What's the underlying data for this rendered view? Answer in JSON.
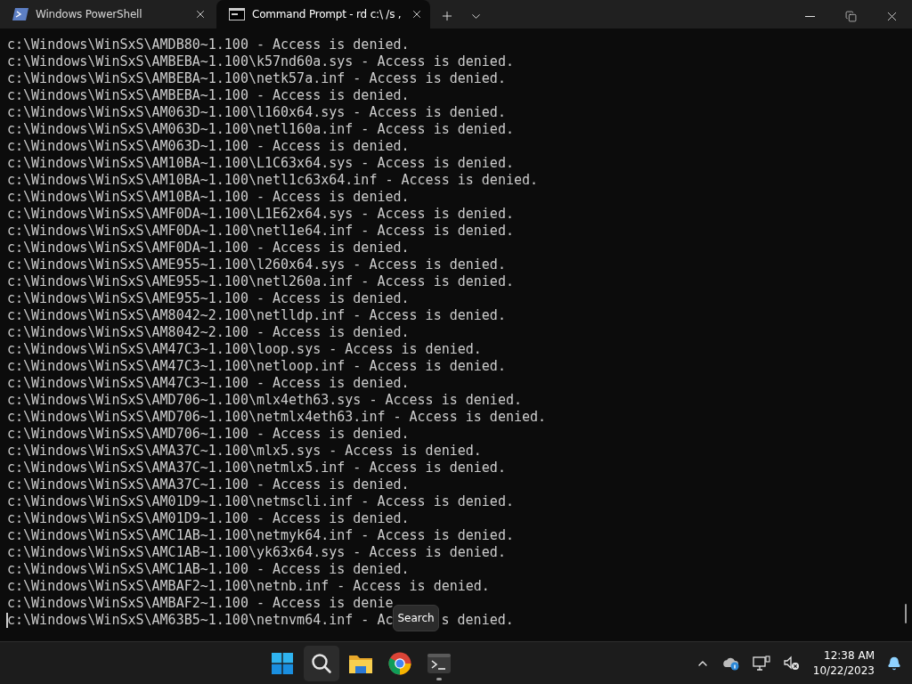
{
  "tabs": [
    {
      "title": "Windows PowerShell",
      "kind": "powershell",
      "selected": false
    },
    {
      "title": "Command Prompt - rd  c:\\ /s ,",
      "kind": "cmd",
      "selected": true
    }
  ],
  "terminal": {
    "lines": [
      {
        "text": "c:\\Windows\\WinSxS\\AMDB80~1.100 - Access is denied."
      },
      {
        "text": "c:\\Windows\\WinSxS\\AMBEBA~1.100\\k57nd60a.sys - Access is denied."
      },
      {
        "text": "c:\\Windows\\WinSxS\\AMBEBA~1.100\\netk57a.inf - Access is denied."
      },
      {
        "text": "c:\\Windows\\WinSxS\\AMBEBA~1.100 - Access is denied."
      },
      {
        "text": "c:\\Windows\\WinSxS\\AM063D~1.100\\l160x64.sys - Access is denied."
      },
      {
        "text": "c:\\Windows\\WinSxS\\AM063D~1.100\\netl160a.inf - Access is denied."
      },
      {
        "text": "c:\\Windows\\WinSxS\\AM063D~1.100 - Access is denied."
      },
      {
        "text": "c:\\Windows\\WinSxS\\AM10BA~1.100\\L1C63x64.sys - Access is denied."
      },
      {
        "text": "c:\\Windows\\WinSxS\\AM10BA~1.100\\netl1c63x64.inf - Access is denied."
      },
      {
        "text": "c:\\Windows\\WinSxS\\AM10BA~1.100 - Access is denied."
      },
      {
        "text": "c:\\Windows\\WinSxS\\AMF0DA~1.100\\L1E62x64.sys - Access is denied."
      },
      {
        "text": "c:\\Windows\\WinSxS\\AMF0DA~1.100\\netl1e64.inf - Access is denied."
      },
      {
        "text": "c:\\Windows\\WinSxS\\AMF0DA~1.100 - Access is denied."
      },
      {
        "text": "c:\\Windows\\WinSxS\\AME955~1.100\\l260x64.sys - Access is denied."
      },
      {
        "text": "c:\\Windows\\WinSxS\\AME955~1.100\\netl260a.inf - Access is denied."
      },
      {
        "text": "c:\\Windows\\WinSxS\\AME955~1.100 - Access is denied."
      },
      {
        "text": "c:\\Windows\\WinSxS\\AM8042~2.100\\netlldp.inf - Access is denied."
      },
      {
        "text": "c:\\Windows\\WinSxS\\AM8042~2.100 - Access is denied."
      },
      {
        "text": "c:\\Windows\\WinSxS\\AM47C3~1.100\\loop.sys - Access is denied."
      },
      {
        "text": "c:\\Windows\\WinSxS\\AM47C3~1.100\\netloop.inf - Access is denied."
      },
      {
        "text": "c:\\Windows\\WinSxS\\AM47C3~1.100 - Access is denied."
      },
      {
        "text": "c:\\Windows\\WinSxS\\AMD706~1.100\\mlx4eth63.sys - Access is denied."
      },
      {
        "text": "c:\\Windows\\WinSxS\\AMD706~1.100\\netmlx4eth63.inf - Access is denied."
      },
      {
        "text": "c:\\Windows\\WinSxS\\AMD706~1.100 - Access is denied."
      },
      {
        "text": "c:\\Windows\\WinSxS\\AMA37C~1.100\\mlx5.sys - Access is denied."
      },
      {
        "text": "c:\\Windows\\WinSxS\\AMA37C~1.100\\netmlx5.inf - Access is denied."
      },
      {
        "text": "c:\\Windows\\WinSxS\\AMA37C~1.100 - Access is denied."
      },
      {
        "text": "c:\\Windows\\WinSxS\\AM01D9~1.100\\netmscli.inf - Access is denied."
      },
      {
        "text": "c:\\Windows\\WinSxS\\AM01D9~1.100 - Access is denied."
      },
      {
        "text": "c:\\Windows\\WinSxS\\AMC1AB~1.100\\netmyk64.inf - Access is denied."
      },
      {
        "text": "c:\\Windows\\WinSxS\\AMC1AB~1.100\\yk63x64.sys - Access is denied."
      },
      {
        "text": "c:\\Windows\\WinSxS\\AMC1AB~1.100 - Access is denied."
      },
      {
        "text": "c:\\Windows\\WinSxS\\AMBAF2~1.100\\netnb.inf - Access is denied."
      },
      {
        "text": "c:\\Windows\\WinSxS\\AMBAF2~1.100 - Access is denie"
      },
      {
        "text": "c:\\Windows\\WinSxS\\AM63B5~1.100\\netnvm64.inf - Ac",
        "after": "s denied.",
        "cursor": true
      }
    ]
  },
  "tooltip": "Search",
  "taskbar": {
    "apps": [
      {
        "kind": "start",
        "hovered": false,
        "running": false
      },
      {
        "kind": "search",
        "hovered": true,
        "running": false
      },
      {
        "kind": "folder",
        "hovered": false,
        "running": false
      },
      {
        "kind": "chrome",
        "hovered": false,
        "running": false
      },
      {
        "kind": "terminal",
        "hovered": false,
        "running": true
      }
    ],
    "time": "12:38 AM",
    "date": "10/22/2023"
  }
}
